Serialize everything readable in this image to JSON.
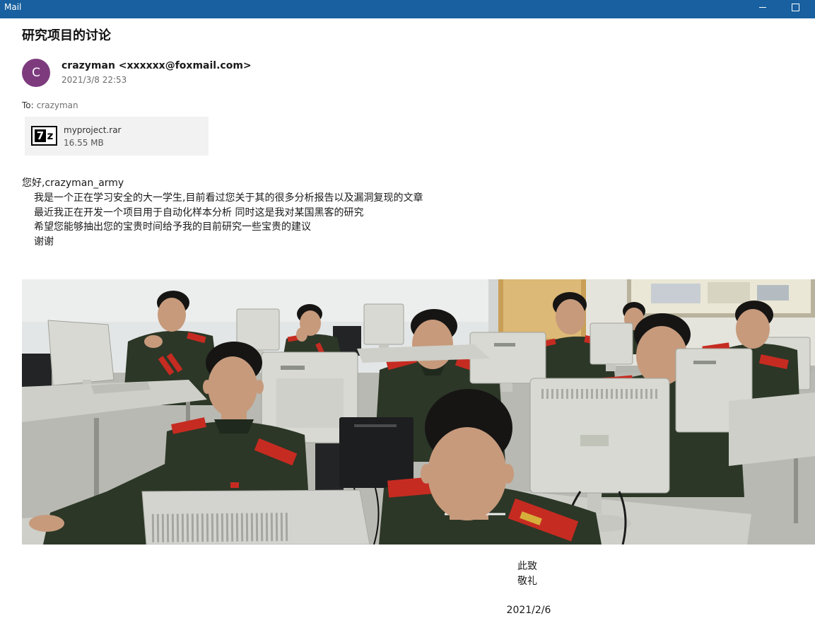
{
  "window": {
    "title": "Mail",
    "controls": {
      "minimize": "minimize-icon",
      "maximize": "maximize-icon"
    },
    "titlebar_color": "#18609f"
  },
  "message": {
    "subject": "研究项目的讨论",
    "sender": {
      "initial": "C",
      "display": "crazyman <xxxxxx@foxmail.com>",
      "avatar_color": "#7d3b7e"
    },
    "date": "2021/3/8 22:53",
    "recipients": {
      "label": "To:",
      "value": "crazyman"
    },
    "attachments": [
      {
        "icon": "7z-archive-icon",
        "icon_mark": [
          "7",
          "z"
        ],
        "name": "myproject.rar",
        "size": "16.55 MB"
      }
    ],
    "body": {
      "greeting": "您好,crazyman_army",
      "lines": [
        "我是一个正在学习安全的大一学生,目前看过您关于其的很多分析报告以及漏洞复现的文章",
        "最近我正在开发一个项目用于自动化样本分析 同时这是我对某国黑客的研究",
        "希望您能够抽出您的宝贵时间给予我的目前研究一些宝贵的建议",
        "谢谢"
      ]
    },
    "closing": {
      "lines": [
        "此致",
        "敬礼"
      ],
      "date": "2021/2/6"
    }
  },
  "colors": {
    "accent": "#18609f",
    "attachment_background": "#f2f2f2"
  }
}
